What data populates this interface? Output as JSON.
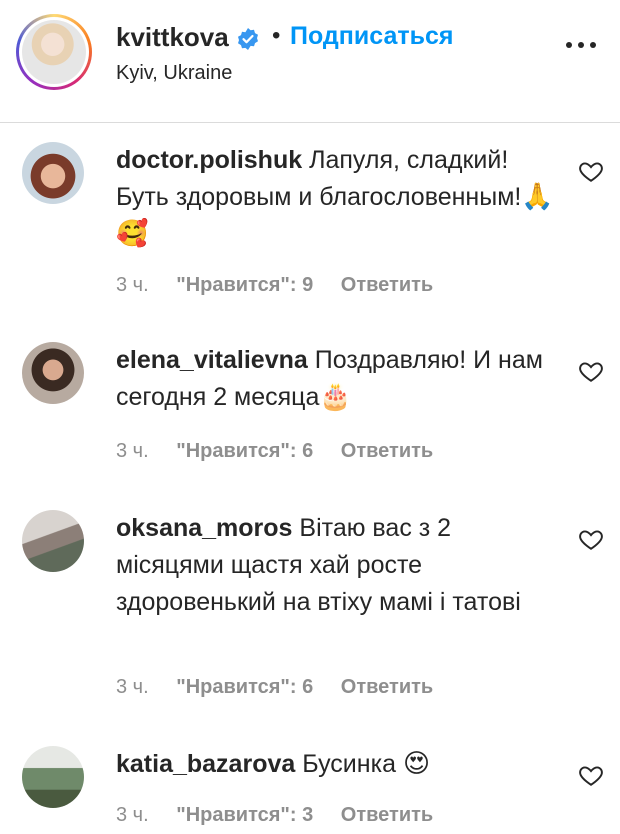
{
  "post": {
    "author": "kvittkova",
    "separator": "•",
    "follow_label": "Подписаться",
    "location": "Kyiv, Ukraine"
  },
  "comments": [
    {
      "user": "doctor.polishuk",
      "text": "Лапуля, сладкий! Буть здоровым и благословенным!",
      "emoji": "🙏🥰",
      "time": "3 ч.",
      "likes": "\"Нравится\": 9",
      "reply": "Ответить"
    },
    {
      "user": "elena_vitalievna",
      "text": "Поздравляю! И нам сегодня 2 месяца",
      "emoji": "🎂",
      "time": "3 ч.",
      "likes": "\"Нравится\": 6",
      "reply": "Ответить"
    },
    {
      "user": "oksana_moros",
      "text": "Вітаю вас з 2 місяцями щастя хай росте здоровенький на втіху мамі і татові",
      "emoji": "",
      "time": "3 ч.",
      "likes": "\"Нравится\": 6",
      "reply": "Ответить"
    },
    {
      "user": "katia_bazarova",
      "text": "Бусинка",
      "emoji": "😍",
      "time": "3 ч.",
      "likes": "\"Нравится\": 3",
      "reply": "Ответить"
    }
  ],
  "icons": {
    "verified": "verified-badge-icon",
    "more": "more-options-icon",
    "like": "heart-outline-icon"
  },
  "colors": {
    "link_blue": "#0095f6",
    "text": "#262626",
    "secondary": "#8e8e8e",
    "verified": "#3897f0"
  }
}
